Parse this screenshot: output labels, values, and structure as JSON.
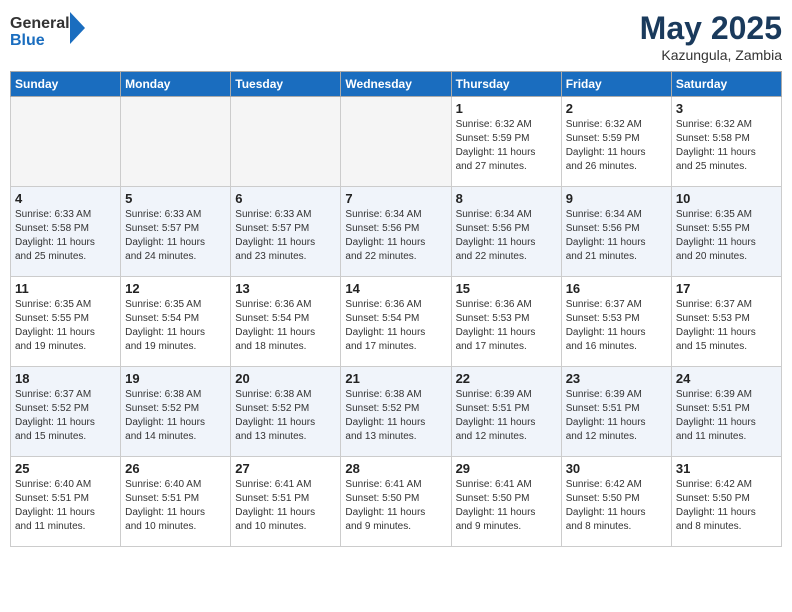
{
  "header": {
    "logo_general": "General",
    "logo_blue": "Blue",
    "month_year": "May 2025",
    "location": "Kazungula, Zambia"
  },
  "days_of_week": [
    "Sunday",
    "Monday",
    "Tuesday",
    "Wednesday",
    "Thursday",
    "Friday",
    "Saturday"
  ],
  "weeks": [
    [
      {
        "day": "",
        "info": ""
      },
      {
        "day": "",
        "info": ""
      },
      {
        "day": "",
        "info": ""
      },
      {
        "day": "",
        "info": ""
      },
      {
        "day": "1",
        "info": "Sunrise: 6:32 AM\nSunset: 5:59 PM\nDaylight: 11 hours\nand 27 minutes."
      },
      {
        "day": "2",
        "info": "Sunrise: 6:32 AM\nSunset: 5:59 PM\nDaylight: 11 hours\nand 26 minutes."
      },
      {
        "day": "3",
        "info": "Sunrise: 6:32 AM\nSunset: 5:58 PM\nDaylight: 11 hours\nand 25 minutes."
      }
    ],
    [
      {
        "day": "4",
        "info": "Sunrise: 6:33 AM\nSunset: 5:58 PM\nDaylight: 11 hours\nand 25 minutes."
      },
      {
        "day": "5",
        "info": "Sunrise: 6:33 AM\nSunset: 5:57 PM\nDaylight: 11 hours\nand 24 minutes."
      },
      {
        "day": "6",
        "info": "Sunrise: 6:33 AM\nSunset: 5:57 PM\nDaylight: 11 hours\nand 23 minutes."
      },
      {
        "day": "7",
        "info": "Sunrise: 6:34 AM\nSunset: 5:56 PM\nDaylight: 11 hours\nand 22 minutes."
      },
      {
        "day": "8",
        "info": "Sunrise: 6:34 AM\nSunset: 5:56 PM\nDaylight: 11 hours\nand 22 minutes."
      },
      {
        "day": "9",
        "info": "Sunrise: 6:34 AM\nSunset: 5:56 PM\nDaylight: 11 hours\nand 21 minutes."
      },
      {
        "day": "10",
        "info": "Sunrise: 6:35 AM\nSunset: 5:55 PM\nDaylight: 11 hours\nand 20 minutes."
      }
    ],
    [
      {
        "day": "11",
        "info": "Sunrise: 6:35 AM\nSunset: 5:55 PM\nDaylight: 11 hours\nand 19 minutes."
      },
      {
        "day": "12",
        "info": "Sunrise: 6:35 AM\nSunset: 5:54 PM\nDaylight: 11 hours\nand 19 minutes."
      },
      {
        "day": "13",
        "info": "Sunrise: 6:36 AM\nSunset: 5:54 PM\nDaylight: 11 hours\nand 18 minutes."
      },
      {
        "day": "14",
        "info": "Sunrise: 6:36 AM\nSunset: 5:54 PM\nDaylight: 11 hours\nand 17 minutes."
      },
      {
        "day": "15",
        "info": "Sunrise: 6:36 AM\nSunset: 5:53 PM\nDaylight: 11 hours\nand 17 minutes."
      },
      {
        "day": "16",
        "info": "Sunrise: 6:37 AM\nSunset: 5:53 PM\nDaylight: 11 hours\nand 16 minutes."
      },
      {
        "day": "17",
        "info": "Sunrise: 6:37 AM\nSunset: 5:53 PM\nDaylight: 11 hours\nand 15 minutes."
      }
    ],
    [
      {
        "day": "18",
        "info": "Sunrise: 6:37 AM\nSunset: 5:52 PM\nDaylight: 11 hours\nand 15 minutes."
      },
      {
        "day": "19",
        "info": "Sunrise: 6:38 AM\nSunset: 5:52 PM\nDaylight: 11 hours\nand 14 minutes."
      },
      {
        "day": "20",
        "info": "Sunrise: 6:38 AM\nSunset: 5:52 PM\nDaylight: 11 hours\nand 13 minutes."
      },
      {
        "day": "21",
        "info": "Sunrise: 6:38 AM\nSunset: 5:52 PM\nDaylight: 11 hours\nand 13 minutes."
      },
      {
        "day": "22",
        "info": "Sunrise: 6:39 AM\nSunset: 5:51 PM\nDaylight: 11 hours\nand 12 minutes."
      },
      {
        "day": "23",
        "info": "Sunrise: 6:39 AM\nSunset: 5:51 PM\nDaylight: 11 hours\nand 12 minutes."
      },
      {
        "day": "24",
        "info": "Sunrise: 6:39 AM\nSunset: 5:51 PM\nDaylight: 11 hours\nand 11 minutes."
      }
    ],
    [
      {
        "day": "25",
        "info": "Sunrise: 6:40 AM\nSunset: 5:51 PM\nDaylight: 11 hours\nand 11 minutes."
      },
      {
        "day": "26",
        "info": "Sunrise: 6:40 AM\nSunset: 5:51 PM\nDaylight: 11 hours\nand 10 minutes."
      },
      {
        "day": "27",
        "info": "Sunrise: 6:41 AM\nSunset: 5:51 PM\nDaylight: 11 hours\nand 10 minutes."
      },
      {
        "day": "28",
        "info": "Sunrise: 6:41 AM\nSunset: 5:50 PM\nDaylight: 11 hours\nand 9 minutes."
      },
      {
        "day": "29",
        "info": "Sunrise: 6:41 AM\nSunset: 5:50 PM\nDaylight: 11 hours\nand 9 minutes."
      },
      {
        "day": "30",
        "info": "Sunrise: 6:42 AM\nSunset: 5:50 PM\nDaylight: 11 hours\nand 8 minutes."
      },
      {
        "day": "31",
        "info": "Sunrise: 6:42 AM\nSunset: 5:50 PM\nDaylight: 11 hours\nand 8 minutes."
      }
    ]
  ]
}
